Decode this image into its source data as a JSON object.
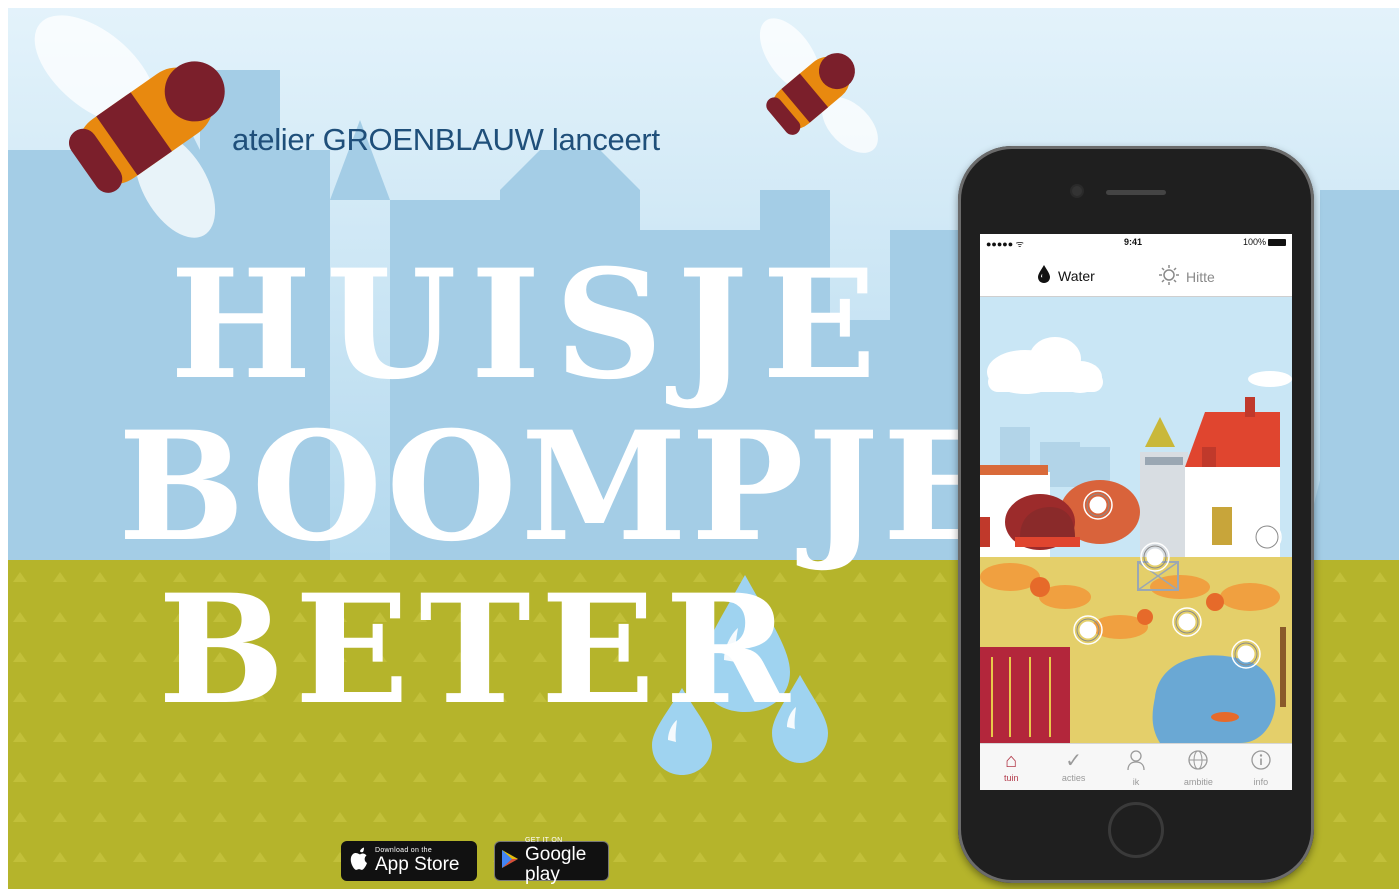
{
  "colors": {
    "sky_top": "#dff0f9",
    "sky": "#b8dcef",
    "skyline": "#9ecae4",
    "grass": "#b7b52a",
    "headline": "#ffffff",
    "tagline": "#1f4f7a",
    "drop": "#9fd3f0",
    "bee_body": "#7b1f2b",
    "bee_stripe": "#e8890f",
    "accent_active": "#b33a4a"
  },
  "banner": {
    "tagline": "atelier GROENBLAUW lanceert",
    "headline": [
      "HUISJE",
      "BOOMPJE",
      "BETER"
    ]
  },
  "stores": {
    "apple": {
      "small": "Download on the",
      "big": "App Store",
      "icon": "apple-icon"
    },
    "google": {
      "small": "GET IT ON",
      "big": "Google play",
      "icon": "play-triangle-icon"
    }
  },
  "phone": {
    "status": {
      "signal": "●●●●● ᯤ",
      "time": "9:41",
      "battery": "100%"
    },
    "top_tabs": [
      {
        "label": "Water",
        "icon": "water-drop-icon",
        "active": true
      },
      {
        "label": "Hitte",
        "icon": "sun-icon",
        "active": false
      }
    ],
    "nav": [
      {
        "label": "tuin",
        "icon": "garden-house-icon",
        "active": true
      },
      {
        "label": "acties",
        "icon": "checklist-icon",
        "active": false
      },
      {
        "label": "ik",
        "icon": "user-icon",
        "active": false
      },
      {
        "label": "ambitie",
        "icon": "globe-icon",
        "active": false
      },
      {
        "label": "info",
        "icon": "info-icon",
        "active": false
      }
    ]
  }
}
